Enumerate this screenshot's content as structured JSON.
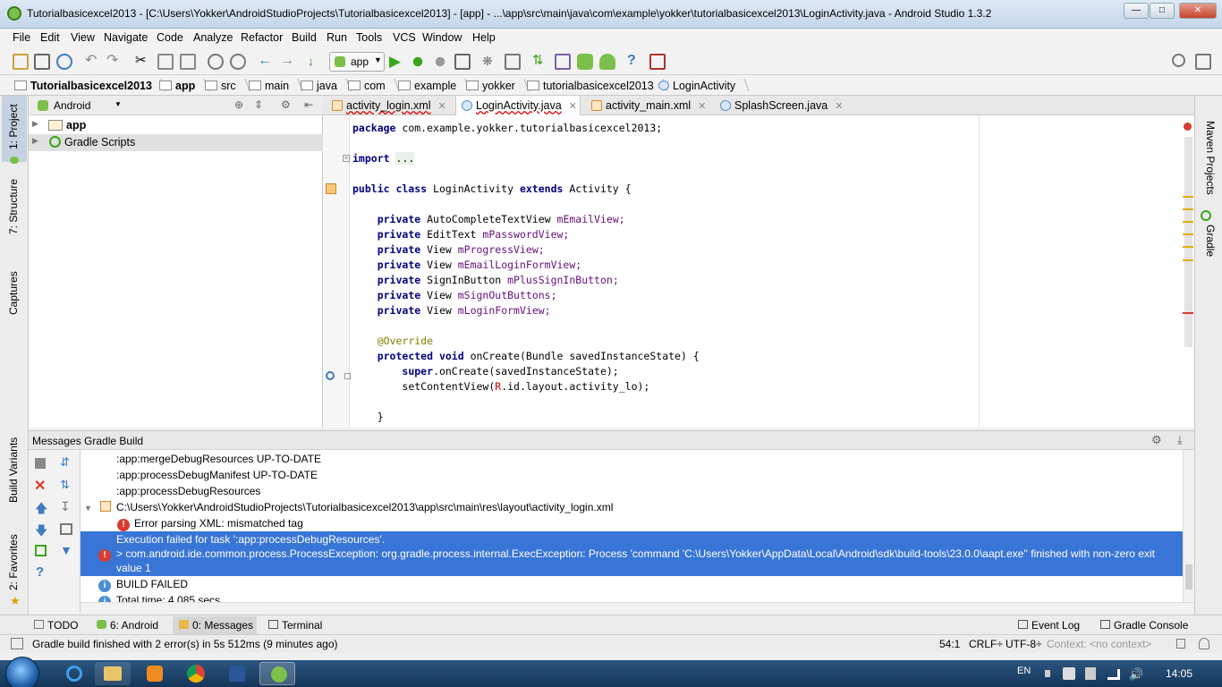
{
  "window": {
    "title": "Tutorialbasicexcel2013 - [C:\\Users\\Yokker\\AndroidStudioProjects\\Tutorialbasicexcel2013] - [app] - ...\\app\\src\\main\\java\\com\\example\\yokker\\tutorialbasicexcel2013\\LoginActivity.java - Android Studio 1.3.2"
  },
  "menu": [
    "File",
    "Edit",
    "View",
    "Navigate",
    "Code",
    "Analyze",
    "Refactor",
    "Build",
    "Run",
    "Tools",
    "VCS",
    "Window",
    "Help"
  ],
  "toolbar": {
    "run_config": "app"
  },
  "breadcrumb": [
    "Tutorialbasicexcel2013",
    "app",
    "src",
    "main",
    "java",
    "com",
    "example",
    "yokker",
    "tutorialbasicexcel2013",
    "LoginActivity"
  ],
  "left_stripe": {
    "project": "1: Project",
    "structure": "7: Structure",
    "captures": "Captures",
    "build_variants": "Build Variants",
    "favorites": "2: Favorites"
  },
  "right_stripe": {
    "maven": "Maven Projects",
    "gradle": "Gradle"
  },
  "project_panel": {
    "view_selector": "Android",
    "tree": [
      "app",
      "Gradle Scripts"
    ]
  },
  "editor": {
    "tabs": [
      {
        "label": "activity_login.xml",
        "active": false
      },
      {
        "label": "LoginActivity.java",
        "active": true
      },
      {
        "label": "activity_main.xml",
        "active": false
      },
      {
        "label": "SplashScreen.java",
        "active": false
      }
    ],
    "lines": {
      "package": "com.example.yokker.tutorialbasicexcel2013;",
      "import_dots": "...",
      "class_name": "LoginActivity",
      "class_parent": "Activity {",
      "f1_type": "AutoCompleteTextView",
      "f1_name": "mEmailView;",
      "f2_type": "EditText",
      "f2_name": "mPasswordView;",
      "f3_type": "View",
      "f3_name": "mProgressView;",
      "f4_type": "View",
      "f4_name": "mEmailLoginFormView;",
      "f5_type": "SignInButton",
      "f5_name": "mPlusSignInButton;",
      "f6_type": "View",
      "f6_name": "mSignOutButtons;",
      "f7_type": "View",
      "f7_name": "mLoginFormView;",
      "annotation": "@Override",
      "oncreate": "onCreate(Bundle savedInstanceState) {",
      "super_call": ".onCreate(savedInstanceState);",
      "setcontent_a": "setContentView(",
      "setcontent_r": "R",
      "setcontent_b": ".id.layout.activity_lo);",
      "close_brace": "}"
    }
  },
  "messages": {
    "header": "Messages Gradle Build",
    "lines": [
      ":app:mergeDebugResources UP-TO-DATE",
      ":app:processDebugManifest UP-TO-DATE",
      ":app:processDebugResources",
      "C:\\Users\\Yokker\\AndroidStudioProjects\\Tutorialbasicexcel2013\\app\\src\\main\\res\\layout\\activity_login.xml",
      "Error parsing XML: mismatched tag",
      "Execution failed for task ':app:processDebugResources'.",
      "> com.android.ide.common.process.ProcessException: org.gradle.process.internal.ExecException: Process 'command 'C:\\Users\\Yokker\\AppData\\Local\\Android\\sdk\\build-tools\\23.0.0\\aapt.exe'' finished with non-zero exit",
      "value 1",
      "BUILD FAILED",
      "Total time: 4.085 secs"
    ]
  },
  "bottom_tabs": [
    "TODO",
    "6: Android",
    "0: Messages",
    "Terminal",
    "Event Log",
    "Gradle Console"
  ],
  "status": {
    "message": "Gradle build finished with 2 error(s) in 5s 512ms (9 minutes ago)",
    "position": "54:1",
    "line_sep": "CRLF÷",
    "encoding": "UTF-8÷",
    "context": "Context: <no context>"
  },
  "taskbar": {
    "lang": "EN",
    "time": "14:05"
  }
}
